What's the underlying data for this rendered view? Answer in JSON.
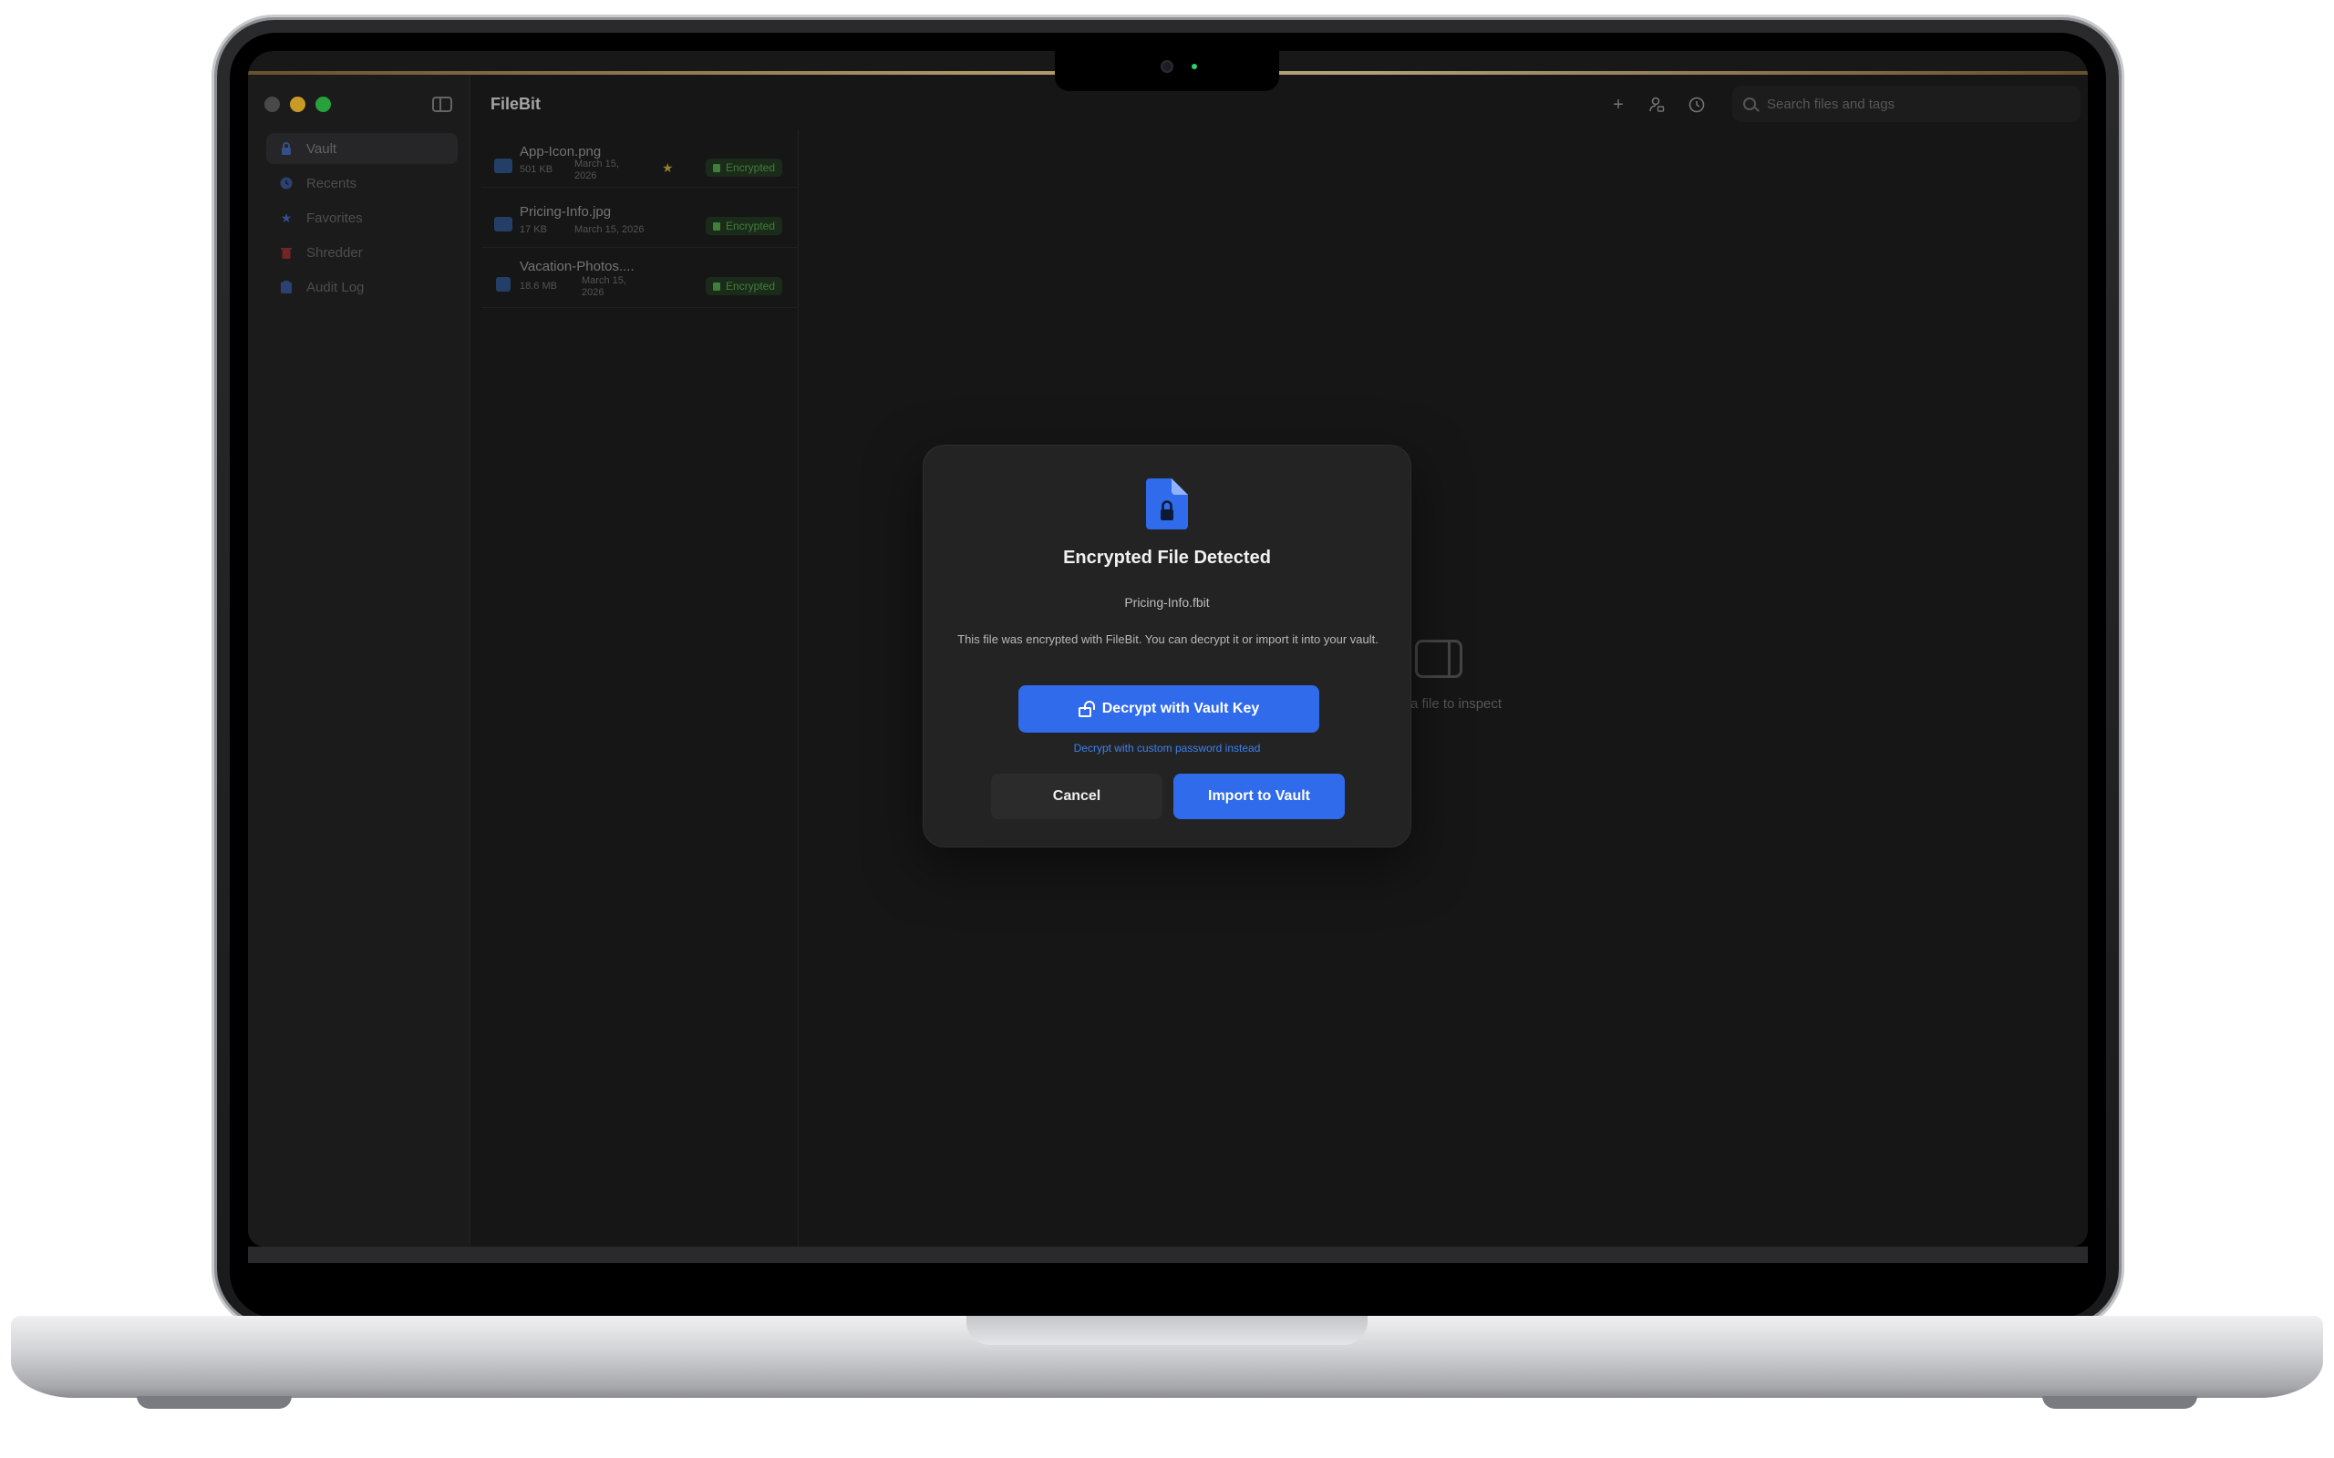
{
  "app": {
    "title": "FileBit",
    "search_placeholder": "Search files and tags"
  },
  "sidebar": {
    "items": [
      {
        "label": "Vault",
        "icon": "lock-icon",
        "active": true
      },
      {
        "label": "Recents",
        "icon": "clock-icon"
      },
      {
        "label": "Favorites",
        "icon": "star-icon"
      },
      {
        "label": "Shredder",
        "icon": "trash-icon"
      },
      {
        "label": "Audit Log",
        "icon": "clipboard-icon"
      }
    ]
  },
  "toolbar": {
    "buttons": [
      "plus-icon",
      "person-lock-icon",
      "history-icon"
    ]
  },
  "files": [
    {
      "name": "App-Icon.png",
      "size": "501 KB",
      "date": "March 15, 2026",
      "badge": "Encrypted",
      "favorite": true,
      "icon": "image-icon"
    },
    {
      "name": "Pricing-Info.jpg",
      "size": "17 KB",
      "date": "March 15, 2026",
      "badge": "Encrypted",
      "favorite": false,
      "icon": "image-icon"
    },
    {
      "name": "Vacation-Photos....",
      "size": "18.6 MB",
      "date": "March 15, 2026",
      "badge": "Encrypted",
      "favorite": false,
      "icon": "archive-icon"
    }
  ],
  "inspector": {
    "empty_text": "a file to inspect"
  },
  "dialog": {
    "title": "Encrypted File Detected",
    "filename": "Pricing-Info.fbit",
    "description": "This file was encrypted with FileBit. You can decrypt it or import it into your vault.",
    "primary_label": "Decrypt with Vault Key",
    "link_label": "Decrypt with custom password instead",
    "cancel_label": "Cancel",
    "import_label": "Import to Vault"
  },
  "colors": {
    "accent": "#2f6bea",
    "badge_green": "#4f9a4a",
    "star": "#b49a36"
  }
}
